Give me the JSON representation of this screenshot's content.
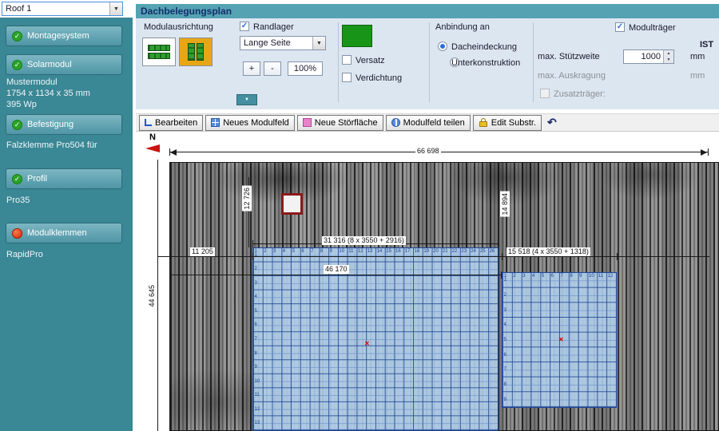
{
  "window": {
    "roof_selector": "Roof 1"
  },
  "icons": {
    "dropdown_arrow": "▼",
    "check": "✓",
    "undo": "↶",
    "spinner_up": "▲",
    "spinner_down": "▼",
    "cross": "✕"
  },
  "colors": {
    "sidebar_teal": "#3a8795",
    "header_teal": "#55a3b2",
    "panel_bg": "#dce6f0",
    "accent_blue": "#2a6de0",
    "grid_blue": "#1e4696",
    "field_fill": "#b0cee6",
    "swatch_green": "#189418",
    "orient_alt_bg": "#e7a614",
    "stoerflaeche_red": "#8b1a1a"
  },
  "sidebar": {
    "sections": [
      {
        "button": "Montagesystem",
        "lines": []
      },
      {
        "button": "Solarmodul",
        "lines": [
          "Mustermodul",
          "1754 x 1134 x 35 mm",
          "395 Wp"
        ]
      },
      {
        "button": "Befestigung",
        "lines": [
          "Falzklemme Pro504 für"
        ]
      },
      {
        "button": "Profil",
        "lines": [
          "Pro35"
        ]
      },
      {
        "button": "Modulklemmen",
        "lines": [
          "RapidPro"
        ]
      }
    ]
  },
  "panel": {
    "title": "Dachbelegungsplan",
    "modulausrichtung_label": "Modulausrichtung",
    "randlager_label": "Randlager",
    "randlager_value": "Lange Seite",
    "zoom_in": "+",
    "zoom_out": "-",
    "zoom_level": "100%",
    "versatz_label": "Versatz",
    "verdichtung_label": "Verdichtung",
    "anbindung_label": "Anbindung an",
    "option_dacheindeckung": "Dacheindeckung",
    "option_unterkonstruktion": "Unterkonstruktion",
    "modultraeger_label": "Modulträger",
    "ist_label": "IST",
    "stuetzweite_label": "max. Stützweite",
    "stuetzweite_value": "1000",
    "stuetzweite_unit": "mm",
    "auskragung_label": "max. Auskragung",
    "auskragung_unit": "mm",
    "zusatztraeger_label": "Zusatzträger:"
  },
  "toolbar": {
    "buttons": [
      {
        "label": "Bearbeiten"
      },
      {
        "label": "Neues Modulfeld"
      },
      {
        "label": "Neue Störfläche"
      },
      {
        "label": "Modulfeld teilen"
      },
      {
        "label": "Edit Substr."
      }
    ]
  },
  "canvas": {
    "north_label": "N",
    "dims": {
      "total_width": "66 698",
      "total_height": "44 645",
      "offset_v1": "12 726",
      "offset_v2": "14 894",
      "field1_width": "31 316 (8 x 3550 + 2916)",
      "left_offset": "11 205",
      "field1_total": "46 170",
      "field2_width": "15 518 (4 x 3550 + 1318)"
    },
    "field1": {
      "cols": 26,
      "rows": 13
    },
    "field2": {
      "cols": 12,
      "rows": 9
    }
  }
}
